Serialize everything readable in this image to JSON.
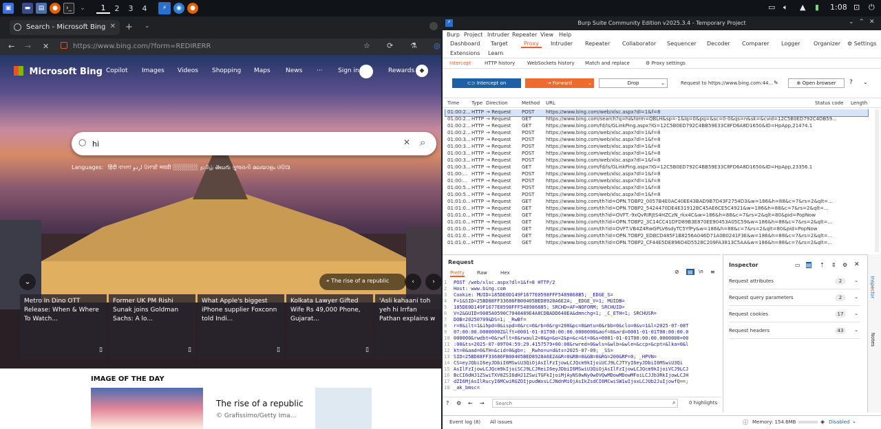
{
  "taskbar": {
    "workspaces": [
      "1",
      "2",
      "3",
      "4"
    ],
    "clock": "1:08"
  },
  "browser": {
    "tab_title": "Search - Microsoft Bing",
    "url": "https://www.bing.com/?form=REDIRERR",
    "logo": "Microsoft Bing",
    "nav": [
      "Copilot",
      "Images",
      "Videos",
      "Shopping",
      "Maps",
      "News"
    ],
    "more": "···",
    "signin": "Sign in",
    "rewards": "Rewards",
    "search_value": "hi",
    "languages_label": "Languages:",
    "languages": "हिंदी  বাংলা  اردو  ਪੰਜਾਬੀ  मराठी  ░░░░░░  தமிழ்  తెలుగు  ગુજરાતી  മലയാളം  ଓଡ଼ିଆ",
    "caption": "The rise of a republic",
    "cards": [
      "Metro In Dino OTT Release: When & Where To Watch...",
      "Former UK PM Rishi Sunak joins Goldman Sachs: A lo...",
      "What Apple's biggest iPhone supplier Foxconn told Indi...",
      "Kolkata Lawyer Gifted Wife Rs 49,000 Phone, Gujarat...",
      "'Asli kahaani toh yeh hi Irrfan Pathan explains w"
    ],
    "iotd_heading": "IMAGE OF THE DAY",
    "iotd_title": "The rise of a republic",
    "iotd_credit": "© Grafissimo/Getty Ima..."
  },
  "burp": {
    "title": "Burp Suite Community Edition v2025.3.4 - Temporary Project",
    "menu": [
      "Burp",
      "Project",
      "Intruder",
      "Repeater",
      "View",
      "Help"
    ],
    "tools": [
      "Dashboard",
      "Target",
      "Proxy",
      "Intruder",
      "Repeater",
      "Collaborator",
      "Sequencer",
      "Decoder",
      "Comparer",
      "Logger",
      "Organizer"
    ],
    "settings": "Settings",
    "tools2": [
      "Extensions",
      "Learn"
    ],
    "subtabs": [
      "Intercept",
      "HTTP history",
      "WebSockets history",
      "Match and replace",
      "Proxy settings"
    ],
    "intercept_on": "Intercept on",
    "forward": "Forward",
    "drop": "Drop",
    "request_to": "Request to https://www.bing.com:44...",
    "open_browser": "Open browser",
    "columns": [
      "Time",
      "Type",
      "Direction",
      "Method",
      "URL",
      "Status code",
      "Length"
    ],
    "rows": [
      {
        "time": "01:00:2...",
        "type": "HTTP",
        "dir": "→  Request",
        "method": "POST",
        "url": "https://www.bing.com/web/xlsc.aspx?dl=1&f=8"
      },
      {
        "time": "01:00:2...",
        "type": "HTTP",
        "dir": "→  Request",
        "method": "GET",
        "url": "https://www.bing.com/search?q=hi&form=QBLH&sp=-1&lq=0&pq=&sc=0-0&qs=n&sk=&cvid=12C5B0ED792C4DB59..."
      },
      {
        "time": "01:00:2...",
        "type": "HTTP",
        "dir": "→  Request",
        "method": "GET",
        "url": "https://www.bing.com/fd/ls/GLinkPing.aspx?IG=12C5B0ED792C4BB59E33C8FD6A8D1650&ID=HpApp,21474.1"
      },
      {
        "time": "01:00:2...",
        "type": "HTTP",
        "dir": "→  Request",
        "method": "POST",
        "url": "https://www.bing.com/web/xlsc.aspx?dl=1&f=8"
      },
      {
        "time": "01:00:3...",
        "type": "HTTP",
        "dir": "→  Request",
        "method": "POST",
        "url": "https://www.bing.com/web/xlsc.aspx?dl=1&f=8"
      },
      {
        "time": "01:00:3...",
        "type": "HTTP",
        "dir": "→  Request",
        "method": "POST",
        "url": "https://www.bing.com/web/xlsc.aspx?dl=1&f=8"
      },
      {
        "time": "01:00:3...",
        "type": "HTTP",
        "dir": "→  Request",
        "method": "POST",
        "url": "https://www.bing.com/web/xlsc.aspx?dl=1&f=8"
      },
      {
        "time": "01:00:3...",
        "type": "HTTP",
        "dir": "→  Request",
        "method": "POST",
        "url": "https://www.bing.com/web/xlsc.aspx?dl=1&f=8"
      },
      {
        "time": "01:00:3...",
        "type": "HTTP",
        "dir": "→  Request",
        "method": "GET",
        "url": "https://www.bing.com/fd/ls/GLinkPing.aspx?IG=12C5B0ED792C4BB59E33C8FD6A8D1650&ID=HpApp,23356.1"
      },
      {
        "time": "01:00:...",
        "type": "HTTP",
        "dir": "→  Request",
        "method": "POST",
        "url": "https://www.bing.com/web/xlsc.aspx?dl=1&f=8"
      },
      {
        "time": "01:00:...",
        "type": "HTTP",
        "dir": "→  Request",
        "method": "POST",
        "url": "https://www.bing.com/web/xlsc.aspx?dl=1&f=8"
      },
      {
        "time": "01:00:5...",
        "type": "HTTP",
        "dir": "→  Request",
        "method": "POST",
        "url": "https://www.bing.com/web/xlsc.aspx?dl=1&f=8"
      },
      {
        "time": "01:00:5...",
        "type": "HTTP",
        "dir": "→  Request",
        "method": "POST",
        "url": "https://www.bing.com/web/xlsc.aspx?dl=1&f=8"
      },
      {
        "time": "01:01:0...",
        "type": "HTTP",
        "dir": "→  Request",
        "method": "GET",
        "url": "https://www.bing.com/th?id=OPN.TOBP2_0057B4E0AC40EE43BAD9B7D43F2754D3&w=186&h=88&c=7&rs=2&qlt=..."
      },
      {
        "time": "01:01:0...",
        "type": "HTTP",
        "dir": "→  Request",
        "method": "GET",
        "url": "https://www.bing.com/th?id=OPN.TOBP2_5424470DE4E31912BC45AE6CE5C4921&w=186&h=88&c=7&rs=2&qlt=..."
      },
      {
        "time": "01:01:0...",
        "type": "HTTP",
        "dir": "→  Request",
        "method": "GET",
        "url": "https://www.bing.com/th?id=OVFT.-9xQvRIRJtS4HZCzN_rkx4C&w=186&h=88&c=7&rs=2&qlt=80&pid=PopNow"
      },
      {
        "time": "01:01:0...",
        "type": "HTTP",
        "dir": "→  Request",
        "method": "GET",
        "url": "https://www.bing.com/th?id=OPN.TOBP2_3C14CC41DFD89B3E870EE90453A05C59&w=186&h=88&c=7&rs=2&qlt=..."
      },
      {
        "time": "01:01:0...",
        "type": "HTTP",
        "dir": "→  Request",
        "method": "GET",
        "url": "https://www.bing.com/th?id=OVFT.VB4Z4RwGPLV6sdyTC5YfPy&w=186&h=88&c=7&rs=2&qlt=80&pid=PopNow"
      },
      {
        "time": "01:01:0...",
        "type": "HTTP",
        "dir": "→  Request",
        "method": "GET",
        "url": "https://www.bing.com/th?id=OPN.TOBP2_EDBCD485F1B8256A046D71A0B0241F3E&w=186&h=88&c=7&rs=2&qlt=..."
      },
      {
        "time": "01:01:0...",
        "type": "HTTP",
        "dir": "→  Request",
        "method": "GET",
        "url": "https://www.bing.com/th?id=OPN.TOBP2_CF44E5DE896D4D5528C209FA3813C5AA&w=186&h=88&c=7&rs=2&qlt=..."
      }
    ],
    "request_title": "Request",
    "request_tabs": [
      "Pretty",
      "Raw",
      "Hex"
    ],
    "request_lines": [
      "POST /web/xlsc.aspx?dl=1&f=8 HTTP/2",
      "Host: www.bing.com",
      "Cookie: MUID=185DE0D149F1677E0598FFF5489868B5; _EDGE_S=",
      "F=1&SID=25BD88FF33686FB00405BED8920A6E2A; _EDGE_V=1; MUIDB=",
      "185DE0D149F1677E0598FFF548986885; SRCHD=AF=NOFORM; SRCHUID=",
      "V=2&GUID=9085A0590C7048489E4A8CDBADD648EA&dmnchg=1; _C_ETH=1; SRCHUSR=",
      "DOB=20250709&DS=1; _RwBf=",
      "r=0&ilt=1&ihpd=0&ispd=0&rc=0&rb=0&rg=200&pc=0&mtu=0&rbb=0&clo=0&v=1&l=2025-07-08T",
      "07:00:00.0000000Z&lft=0001-01-01T00:00:00.0000000&aof=0&ard=0001-01-01T00:00:00.0",
      "000000&rwdbt=0&rwflt=0&rwaul2=0&g=&o=2&p=&c=&t=0&s=0001-01-01T00:00:00.0000000+00",
      ":00&ts=2025-07-09T04:59:29.4157579+00:00&rwred=0&wls=&wlb=&wle=&ccp=&cpt=&lka=0&l",
      "kt=0&aad=0&TH=&cid=0&gb=; _Rwho=u=d&ts=2025-07-09; _SS=",
      "SID=25BD88FF33686FB00405BED8920A6E2A&R=0&RB=0&GB=0&RG=200&RP=0; _HPVN=",
      "CS=eyJQbiI6eyJDbiI6MSwiU3QiOjAsIlFzIjowLCJQcm9kIjoiUCJ9LCJTYyI6eyJDbiI6MSwiU3Qi",
      "AsIlFzIjowLCJQcm9kIjoiSCJ9LCJReiI6eyJDbiI6MSwiU3QiOjAsIlFzIjowLCJQcm9kIjoiVCJ9LCJ",
      "BcCI6dHJ1ZSwiTXV0ZSI6dHJ1ZSwiTGFkIjoiMjAyNS0wNy0wOVQwMDowMDowMFoiLCJJb3RkIjowLCJH",
      "dZI6MjAsIlRucyI6MCwiRGZOIjpudWxsLCJNdnMiOjAsIkZsdCI6MCwiSW1wIjoxLCJUb2JuIjowfQ==;",
      "_ak_bmsc="
    ],
    "search_placeholder": "Search",
    "highlights": "0 highlights",
    "inspector_title": "Inspector",
    "inspector_items": [
      {
        "label": "Request attributes",
        "count": "2"
      },
      {
        "label": "Request query parameters",
        "count": "2"
      },
      {
        "label": "Request cookies",
        "count": "17"
      },
      {
        "label": "Request headers",
        "count": "43"
      }
    ],
    "side_tabs": [
      "Inspector",
      "Notes"
    ],
    "event_log": "Event log (8)",
    "all_issues": "All issues",
    "memory": "Memory: 154.6MB",
    "disabled": "Disabled"
  }
}
